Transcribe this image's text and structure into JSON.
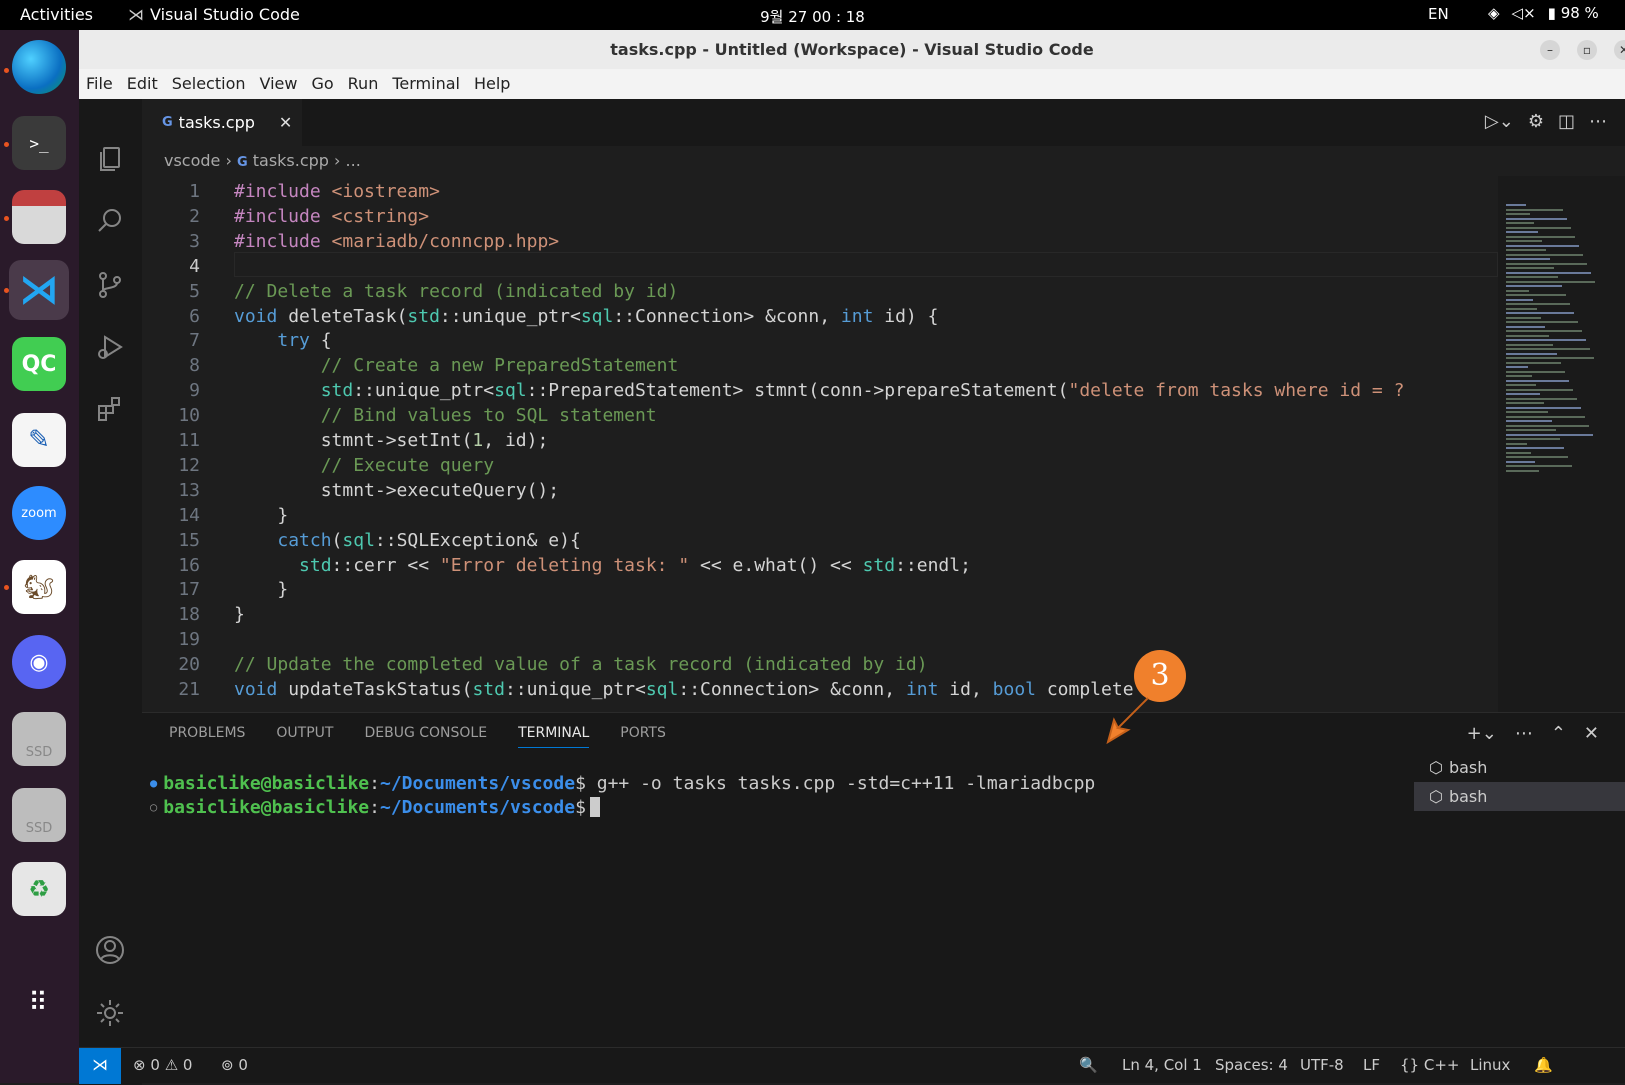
{
  "topbar": {
    "activities": "Activities",
    "app_name": "Visual Studio Code",
    "clock": "9월 27  00 : 18",
    "lang": "EN",
    "battery": "98 %"
  },
  "window": {
    "title": "tasks.cpp - Untitled (Workspace) - Visual Studio Code"
  },
  "menu": [
    "File",
    "Edit",
    "Selection",
    "View",
    "Go",
    "Run",
    "Terminal",
    "Help"
  ],
  "tab": {
    "label": "tasks.cpp",
    "icon": "C++ file icon"
  },
  "breadcrumb": {
    "folder": "vscode",
    "file": "tasks.cpp",
    "rest": "..."
  },
  "editor": {
    "lines": [
      {
        "n": "1",
        "t": "#include <iostream>"
      },
      {
        "n": "2",
        "t": "#include <cstring>"
      },
      {
        "n": "3",
        "t": "#include <mariadb/conncpp.hpp>"
      },
      {
        "n": "4",
        "t": ""
      },
      {
        "n": "5",
        "t": "// Delete a task record (indicated by id)"
      },
      {
        "n": "6",
        "t": "void deleteTask(std::unique_ptr<sql::Connection> &conn, int id) {"
      },
      {
        "n": "7",
        "t": "    try {"
      },
      {
        "n": "8",
        "t": "        // Create a new PreparedStatement"
      },
      {
        "n": "9",
        "t": "        std::unique_ptr<sql::PreparedStatement> stmnt(conn->prepareStatement(\"delete from tasks where id = ?"
      },
      {
        "n": "10",
        "t": "        // Bind values to SQL statement"
      },
      {
        "n": "11",
        "t": "        stmnt->setInt(1, id);"
      },
      {
        "n": "12",
        "t": "        // Execute query"
      },
      {
        "n": "13",
        "t": "        stmnt->executeQuery();"
      },
      {
        "n": "14",
        "t": "    }"
      },
      {
        "n": "15",
        "t": "    catch(sql::SQLException& e){"
      },
      {
        "n": "16",
        "t": "      std::cerr << \"Error deleting task: \" << e.what() << std::endl;"
      },
      {
        "n": "17",
        "t": "    }"
      },
      {
        "n": "18",
        "t": "}"
      },
      {
        "n": "19",
        "t": ""
      },
      {
        "n": "20",
        "t": "// Update the completed value of a task record (indicated by id)"
      },
      {
        "n": "21",
        "t": "void updateTaskStatus(std::unique_ptr<sql::Connection> &conn, int id, bool complete"
      }
    ]
  },
  "panel": {
    "tabs": [
      "PROBLEMS",
      "OUTPUT",
      "DEBUG CONSOLE",
      "TERMINAL",
      "PORTS"
    ],
    "active": "TERMINAL"
  },
  "terminal": {
    "user": "basiclike@basiclike",
    "path": "~/Documents/vscode",
    "prompt": "$",
    "cmd": " g++ -o tasks tasks.cpp -std=c++11 -lmariadbcpp",
    "sessions": [
      "bash",
      "bash"
    ]
  },
  "status": {
    "errors": "0",
    "warnings": "0",
    "ports": "0",
    "position": "Ln 4, Col 1",
    "spaces": "Spaces: 4",
    "encoding": "UTF-8",
    "eol": "LF",
    "lang": "C++",
    "os": "Linux"
  },
  "annotation": {
    "number": "3",
    "color": "#f0802c"
  }
}
